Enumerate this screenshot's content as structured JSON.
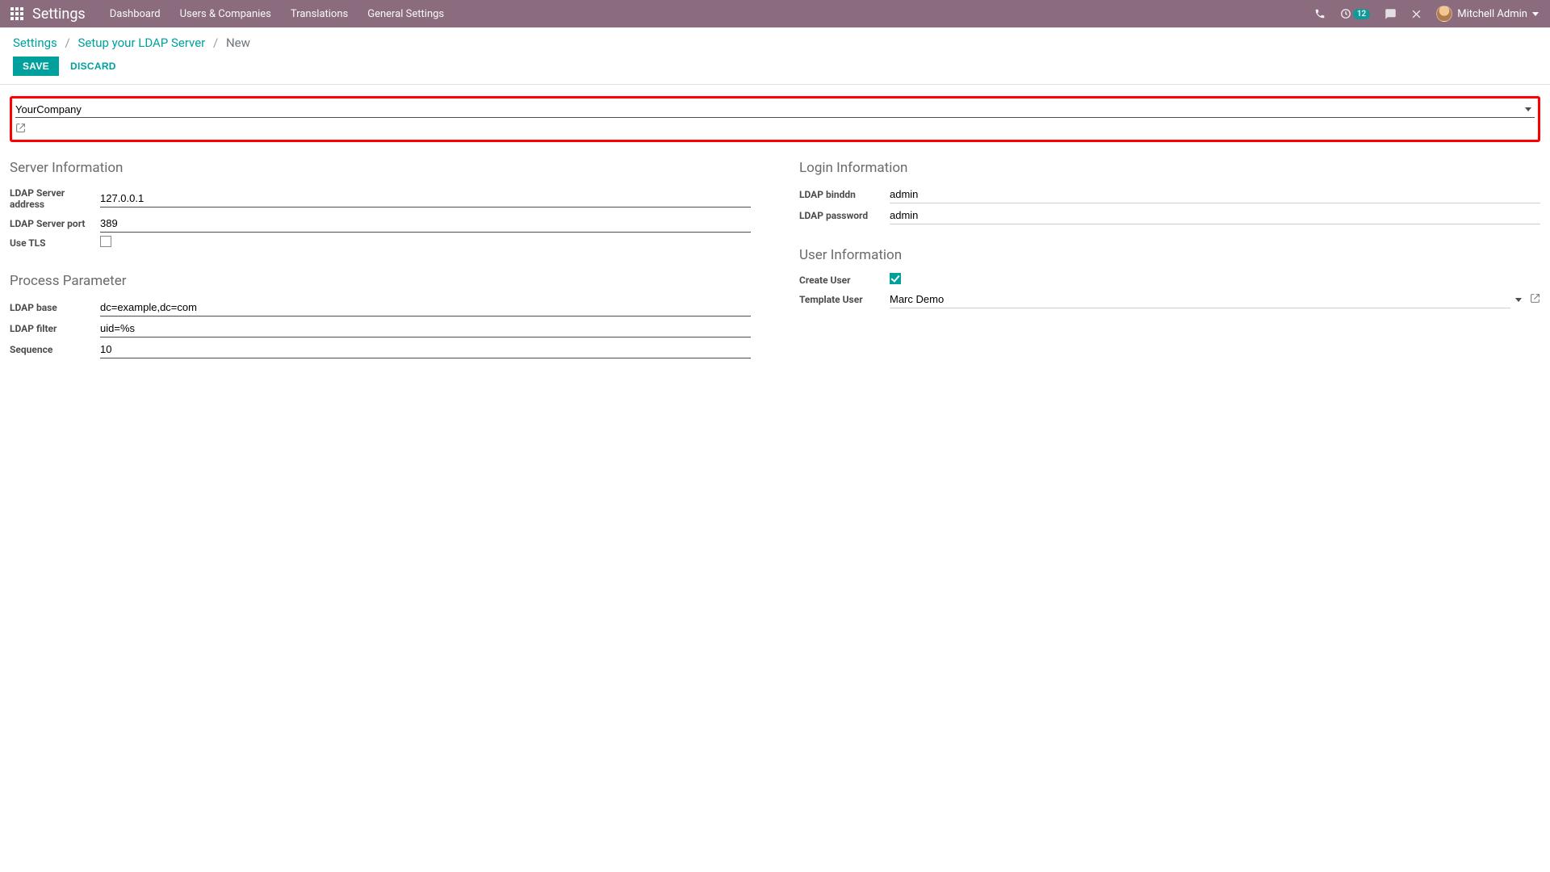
{
  "topbar": {
    "brand": "Settings",
    "nav": [
      "Dashboard",
      "Users & Companies",
      "Translations",
      "General Settings"
    ],
    "activity_count": "12",
    "user_name": "Mitchell Admin"
  },
  "breadcrumb": {
    "a": "Settings",
    "b": "Setup your LDAP Server",
    "c": "New"
  },
  "actions": {
    "save": "SAVE",
    "discard": "DISCARD"
  },
  "company": {
    "value": "YourCompany"
  },
  "sections": {
    "server": {
      "title": "Server Information",
      "address_label": "LDAP Server address",
      "address_value": "127.0.0.1",
      "port_label": "LDAP Server port",
      "port_value": "389",
      "tls_label": "Use TLS"
    },
    "login": {
      "title": "Login Information",
      "binddn_label": "LDAP binddn",
      "binddn_value": "admin",
      "password_label": "LDAP password",
      "password_value": "admin"
    },
    "process": {
      "title": "Process Parameter",
      "base_label": "LDAP base",
      "base_value": "dc=example,dc=com",
      "filter_label": "LDAP filter",
      "filter_value": "uid=%s",
      "sequence_label": "Sequence",
      "sequence_value": "10"
    },
    "user": {
      "title": "User Information",
      "create_label": "Create User",
      "template_label": "Template User",
      "template_value": "Marc Demo"
    }
  }
}
